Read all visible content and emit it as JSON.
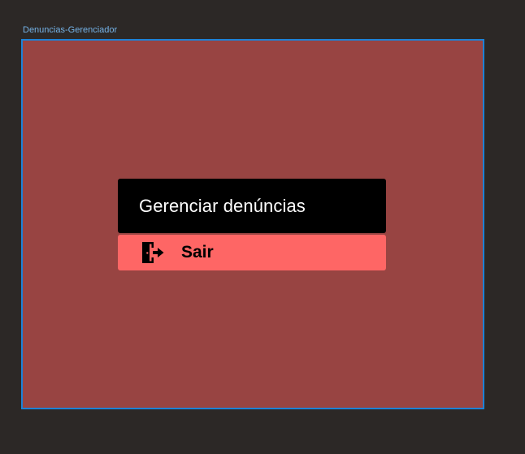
{
  "canvas": {
    "frame_label": "Denuncias-Gerenciador"
  },
  "menu": {
    "title": "Gerenciar denúncias",
    "logout_label": "Sair",
    "logout_icon": "door-exit-icon"
  },
  "colors": {
    "canvas_background": "#2c2826",
    "frame_fill": "#984442",
    "frame_selection_border": "#1d82d6",
    "frame_label_text": "#74b3e8",
    "title_box": "#000000",
    "logout_button": "#fe6665"
  }
}
